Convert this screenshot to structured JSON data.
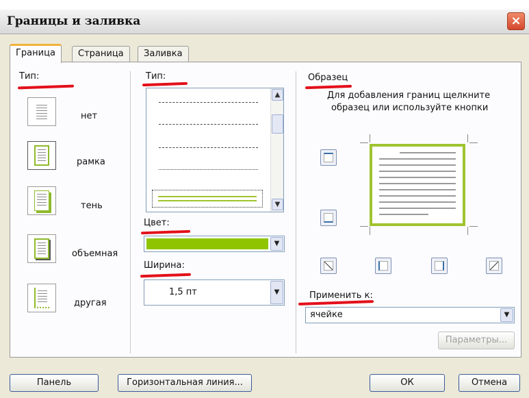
{
  "window": {
    "title": "Границы и заливка",
    "close_glyph": "×"
  },
  "tabs": [
    {
      "label": "Граница"
    },
    {
      "label": "Страница"
    },
    {
      "label": "Заливка"
    }
  ],
  "setting": {
    "label": "Тип:",
    "items": [
      {
        "label": "нет"
      },
      {
        "label": "рамка"
      },
      {
        "label": "тень"
      },
      {
        "label": "объемная"
      },
      {
        "label": "другая"
      }
    ]
  },
  "style": {
    "label": "Тип:",
    "scroll_up": "▲",
    "scroll_down": "▼"
  },
  "color": {
    "label": "Цвет:",
    "value_color": "#8fc400",
    "arrow": "▼"
  },
  "width": {
    "label": "Ширина:",
    "value": "1,5 пт",
    "arrow": "▼"
  },
  "preview": {
    "label": "Образец",
    "hint_line1": "Для добавления границ щелкните",
    "hint_line2": "образец или используйте кнопки"
  },
  "apply_to": {
    "label": "Применить к:",
    "value": "ячейке",
    "arrow": "▼"
  },
  "buttons": {
    "options": "Параметры...",
    "panel": "Панель",
    "horizontal_line": "Горизонтальная линия...",
    "ok": "ОК",
    "cancel": "Отмена"
  },
  "colors": {
    "accent_green": "#8fba2b",
    "annotation_red": "#e3101a",
    "dialog_bg": "#ece9d8"
  }
}
